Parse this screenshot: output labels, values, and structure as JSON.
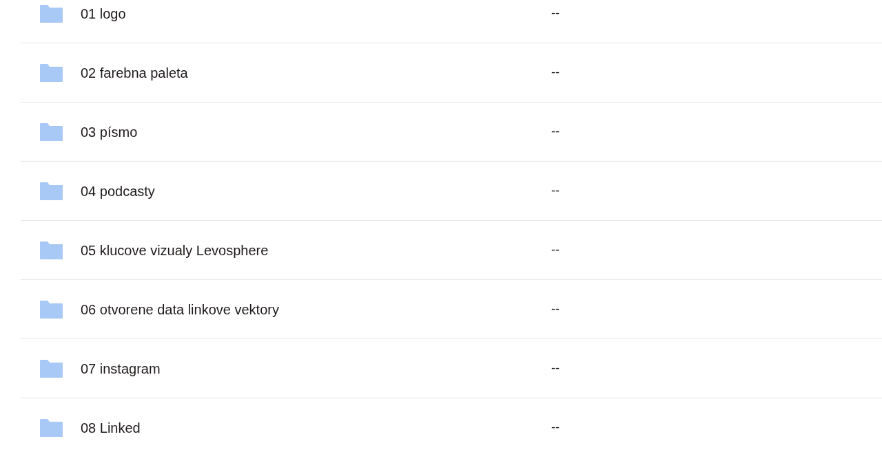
{
  "rows": [
    {
      "name": "01 logo",
      "modified": "--"
    },
    {
      "name": "02 farebna paleta",
      "modified": "--"
    },
    {
      "name": "03 písmo",
      "modified": "--"
    },
    {
      "name": "04 podcasty",
      "modified": "--"
    },
    {
      "name": "05 klucove vizualy Levosphere",
      "modified": "--"
    },
    {
      "name": "06 otvorene data linkove vektory",
      "modified": "--"
    },
    {
      "name": "07 instagram",
      "modified": "--"
    },
    {
      "name": "08 Linked",
      "modified": "--"
    }
  ]
}
